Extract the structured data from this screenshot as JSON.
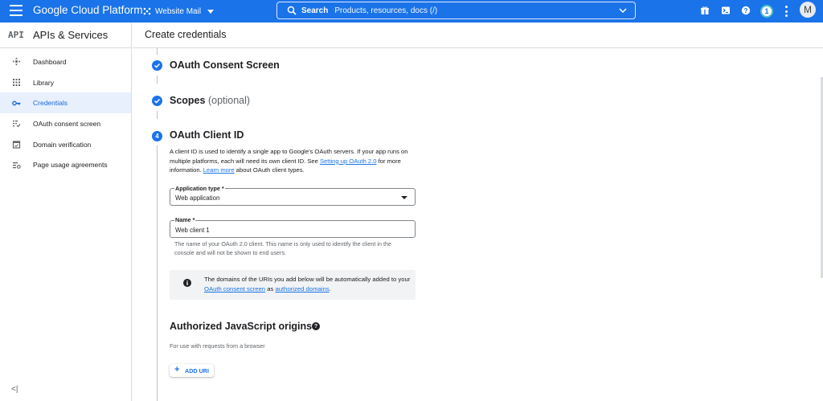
{
  "header": {
    "brand": "Google Cloud Platform",
    "project": "Website Mail",
    "search_label": "Search",
    "search_placeholder": "Products, resources, docs (/)",
    "notification_count": "1",
    "avatar_letter": "M",
    "accent": "#1a73e8"
  },
  "sidebar": {
    "logo": "API",
    "title": "APIs & Services",
    "items": [
      {
        "label": "Dashboard",
        "icon": "dashboard-icon"
      },
      {
        "label": "Library",
        "icon": "library-icon"
      },
      {
        "label": "Credentials",
        "icon": "key-icon",
        "active": true
      },
      {
        "label": "OAuth consent screen",
        "icon": "consent-icon"
      },
      {
        "label": "Domain verification",
        "icon": "calendar-check-icon"
      },
      {
        "label": "Page usage agreements",
        "icon": "settings-list-icon"
      }
    ],
    "collapse": "<|"
  },
  "main": {
    "title": "Create credentials",
    "steps": [
      {
        "title": "OAuth Consent Screen"
      },
      {
        "title": "Scopes",
        "optional": "(optional)"
      },
      {
        "number": "4",
        "title": "OAuth Client ID"
      }
    ],
    "description": {
      "text1": "A client ID is used to identify a single app to Google's OAuth servers. If your app runs on multiple platforms, each will need its own client ID. See ",
      "link1": "Setting up OAuth 2.0",
      "text2": " for more information. ",
      "link2": "Learn more",
      "text3": " about OAuth client types."
    },
    "app_type": {
      "label": "Application type *",
      "value": "Web application"
    },
    "name": {
      "label": "Name *",
      "value": "Web client 1",
      "hint": "The name of your OAuth 2.0 client. This name is only used to identify the client in the console and will not be shown to end users."
    },
    "info": {
      "text1": "The domains of the URIs you add below will be automatically added to your ",
      "link1": "OAuth consent screen",
      "text2": " as ",
      "link2": "authorized domains",
      "text3": "."
    },
    "origins": {
      "title": "Authorized JavaScript origins",
      "help": "?",
      "subtitle": "For use with requests from a browser",
      "add_label": "ADD URI",
      "add_plus": "+"
    }
  }
}
